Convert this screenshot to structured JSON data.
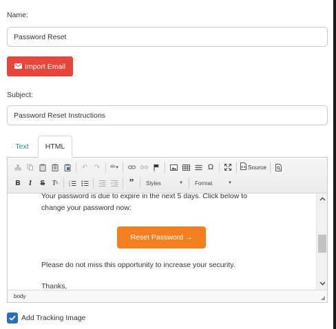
{
  "form": {
    "name_label": "Name:",
    "name_value": "Password Reset",
    "import_label": "Import Email",
    "subject_label": "Subject:",
    "subject_value": "Password Reset Instructions"
  },
  "tabs": [
    {
      "label": "Text",
      "active": false
    },
    {
      "label": "HTML",
      "active": true
    }
  ],
  "toolbar": {
    "row1_icons": [
      "cut-icon",
      "copy-icon",
      "paste-icon",
      "paste-text-icon",
      "paste-word-icon",
      "undo-icon",
      "redo-icon",
      "spellcheck-icon",
      "link-icon",
      "unlink-icon",
      "anchor-icon",
      "image-icon",
      "table-icon",
      "horizontal-rule-icon",
      "special-char-icon",
      "maximize-icon",
      "source-icon",
      "preview-icon"
    ],
    "source_label": "Source",
    "bold": "B",
    "italic": "I",
    "strike": "S",
    "styles_label": "Styles",
    "format_label": "Format"
  },
  "content": {
    "line1": "Your password is due to expire in the next 5 days. Click below to",
    "line2": "change your password now:",
    "button_label": "Reset Password →",
    "line3": "Please do not miss this opportunity to increase your security.",
    "line4": "Thanks,"
  },
  "status": {
    "path": "body"
  },
  "tracking": {
    "label": "Add Tracking Image",
    "checked": true
  },
  "colors": {
    "import_button": "#e8453c",
    "reset_button": "#f47f1e",
    "text_tab": "#1a8a7a",
    "checkbox": "#2a6ebd"
  }
}
